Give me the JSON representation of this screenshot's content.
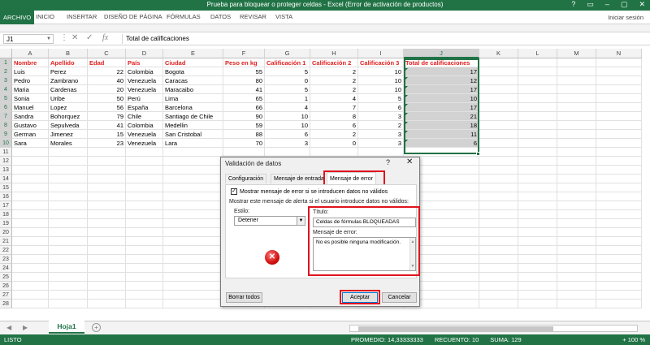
{
  "window": {
    "title": "Prueba para bloquear o proteger celdas -  Excel (Error de activación de productos)",
    "controls": [
      "?",
      "▭",
      "–",
      "▢",
      "✕"
    ]
  },
  "ribbon": {
    "tabs": [
      "ARCHIVO",
      "INICIO",
      "INSERTAR",
      "DISEÑO DE PÁGINA",
      "FÓRMULAS",
      "DATOS",
      "REVISAR",
      "VISTA"
    ],
    "signin": "Iniciar sesión"
  },
  "formula_bar": {
    "name_box": "J1",
    "fx": "fx",
    "content": "Total de calificaciones"
  },
  "columns": [
    "A",
    "B",
    "C",
    "D",
    "E",
    "F",
    "G",
    "H",
    "I",
    "J",
    "K",
    "L",
    "M",
    "N"
  ],
  "rows": [
    "1",
    "2",
    "3",
    "4",
    "5",
    "6",
    "7",
    "8",
    "9",
    "10",
    "11",
    "12",
    "13",
    "14",
    "15",
    "16",
    "17",
    "18",
    "19",
    "20",
    "21",
    "22",
    "23",
    "24",
    "25",
    "26",
    "27",
    "28"
  ],
  "headers": [
    "Nombre",
    "Apellido",
    "Edad",
    "País",
    "Ciudad",
    "Peso en kg",
    "Calificación 1",
    "Calificación 2",
    "Calificación 3",
    "Total de calificaciones"
  ],
  "data_rows": [
    [
      "Luis",
      "Perez",
      "22",
      "Colombia",
      "Bogota",
      "55",
      "5",
      "2",
      "10",
      "17"
    ],
    [
      "Pedro",
      "Zambrano",
      "40",
      "Venezuela",
      "Caracas",
      "80",
      "0",
      "2",
      "10",
      "12"
    ],
    [
      "Maria",
      "Cardenas",
      "20",
      "Venezuela",
      "Maracaibo",
      "41",
      "5",
      "2",
      "10",
      "17"
    ],
    [
      "Sonia",
      "Uribe",
      "50",
      "Perú",
      "Lima",
      "65",
      "1",
      "4",
      "5",
      "10"
    ],
    [
      "Manuel",
      "Lopez",
      "56",
      "España",
      "Barcelona",
      "66",
      "4",
      "7",
      "6",
      "17"
    ],
    [
      "Sandra",
      "Bohorquez",
      "79",
      "Chile",
      "Santiago de Chile",
      "90",
      "10",
      "8",
      "3",
      "21"
    ],
    [
      "Gustavo",
      "Sepulveda",
      "41",
      "Colombia",
      "Medellin",
      "59",
      "10",
      "6",
      "2",
      "18"
    ],
    [
      "German",
      "Jimenez",
      "15",
      "Venezuela",
      "San Cristobal",
      "88",
      "6",
      "2",
      "3",
      "11"
    ],
    [
      "Sara",
      "Morales",
      "23",
      "Venezuela",
      "Lara",
      "70",
      "3",
      "0",
      "3",
      "6"
    ]
  ],
  "sheet": {
    "tab": "Hoja1",
    "nav_prev": "◀",
    "nav_next": "▶",
    "add": "+"
  },
  "status": {
    "mode": "LISTO",
    "promedio": "PROMEDIO: 14,33333333",
    "recuento": "RECUENTO: 10",
    "suma": "SUMA: 129",
    "zoom": "+  100 %"
  },
  "dialog": {
    "title": "Validación de datos",
    "help": "?",
    "close": "✕",
    "tabs": [
      "Configuración",
      "Mensaje de entrada",
      "Mensaje de error"
    ],
    "checkbox_label": "Mostrar mensaje de error si se introducen datos no válidos",
    "checkbox_mark": "✓",
    "instruction": "Mostrar este mensaje de alerta si el usuario introduce datos no válidos:",
    "style_label": "Estilo:",
    "style_value": "Detener",
    "title_label": "Título:",
    "title_value": "Celdas de fórmulas BLOQUEADAS",
    "error_label": "Mensaje de error:",
    "error_value": "No es posible ninguna modificación.",
    "clear_btn": "Borrar todos",
    "ok_btn": "Aceptar",
    "cancel_btn": "Cancelar"
  },
  "colors": {
    "excel_green": "#217346",
    "header_red": "#e02020",
    "highlight_red": "#e0141e"
  }
}
